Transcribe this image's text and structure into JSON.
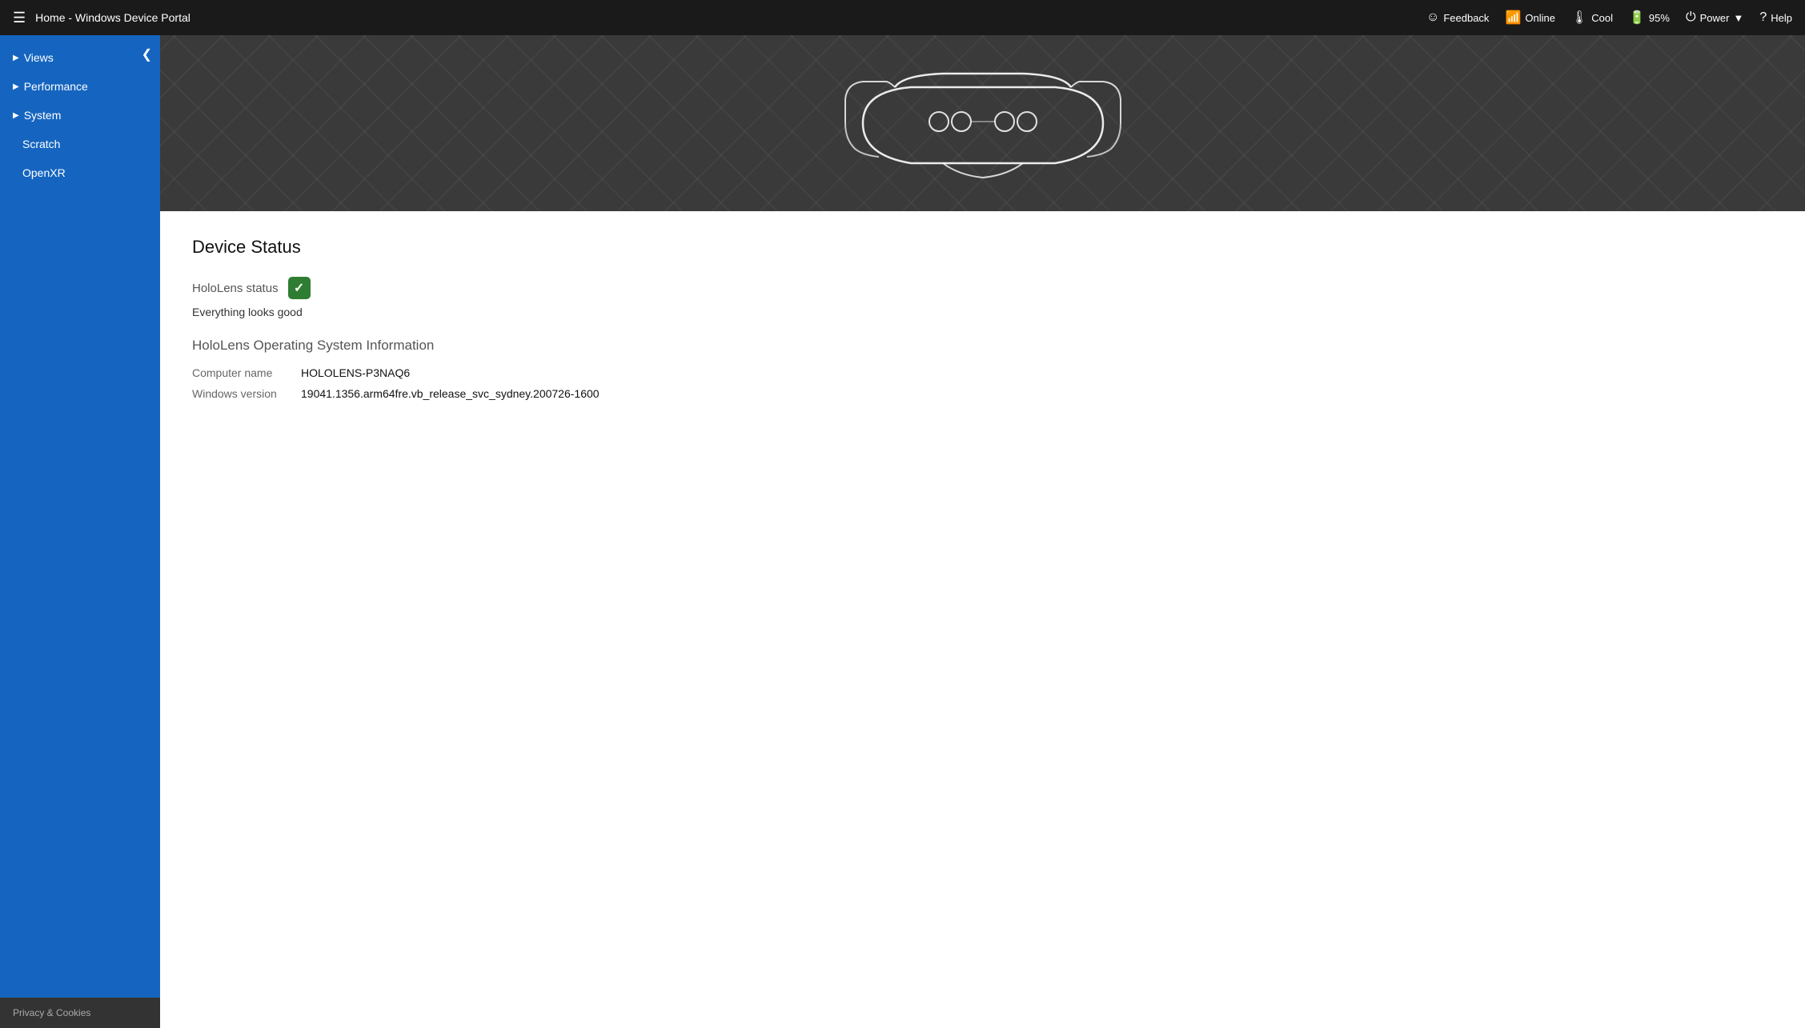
{
  "header": {
    "title": "Home - Windows Device Portal",
    "actions": {
      "feedback": "Feedback",
      "online": "Online",
      "cool": "Cool",
      "battery": "95%",
      "power": "Power",
      "help": "Help"
    }
  },
  "sidebar": {
    "collapse_label": "❮",
    "items": [
      {
        "id": "views",
        "label": "Views",
        "has_arrow": true
      },
      {
        "id": "performance",
        "label": "Performance",
        "has_arrow": true
      },
      {
        "id": "system",
        "label": "System",
        "has_arrow": true
      },
      {
        "id": "scratch",
        "label": "Scratch",
        "has_arrow": false,
        "sub": true
      },
      {
        "id": "openxr",
        "label": "OpenXR",
        "has_arrow": false,
        "sub": true
      }
    ],
    "footer": "Privacy & Cookies"
  },
  "content": {
    "device_status": {
      "title": "Device Status",
      "hololens_status_label": "HoloLens status",
      "status_good_text": "Everything looks good",
      "os_info_title": "HoloLens Operating System Information",
      "computer_name_label": "Computer name",
      "computer_name_value": "HOLOLENS-P3NAQ6",
      "windows_version_label": "Windows version",
      "windows_version_value": "19041.1356.arm64fre.vb_release_svc_sydney.200726-1600"
    }
  }
}
